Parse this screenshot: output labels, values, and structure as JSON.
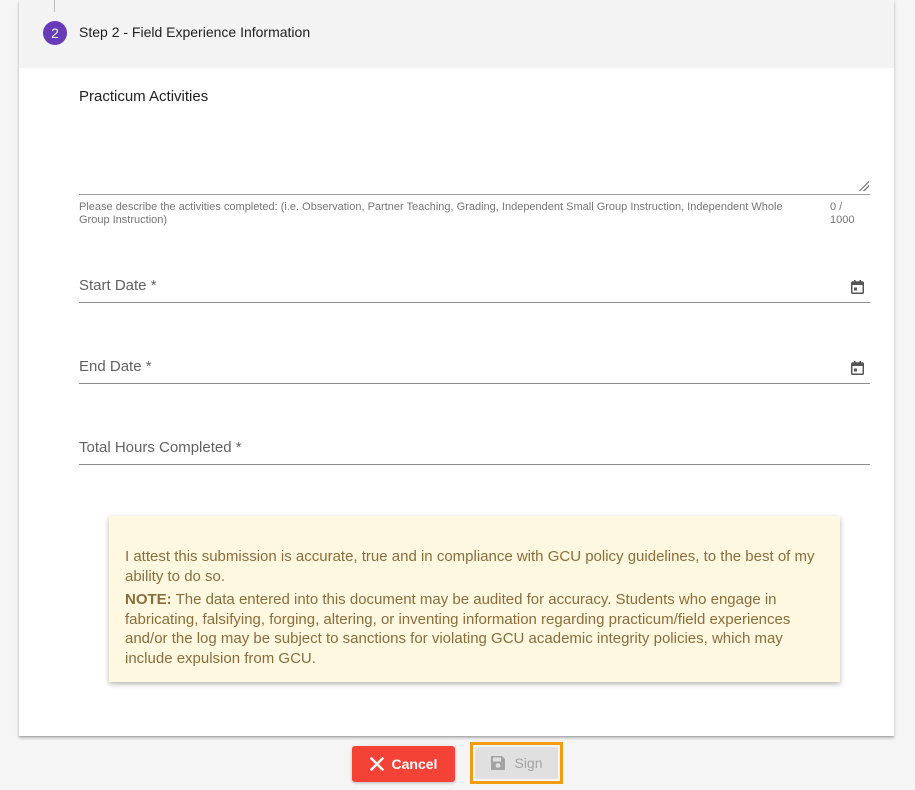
{
  "step": {
    "number": "2",
    "title": "Step 2 - Field Experience Information"
  },
  "practicum": {
    "label": "Practicum Activities",
    "value": "",
    "hint": "Please describe the activities completed: (i.e. Observation, Partner Teaching, Grading, Independent Small Group Instruction, Independent Whole Group Instruction)",
    "counter": "0 / 1000"
  },
  "start_date": {
    "label": "Start Date *",
    "icon": "calendar-icon"
  },
  "end_date": {
    "label": "End Date *",
    "icon": "calendar-icon"
  },
  "total_hours": {
    "label": "Total Hours Completed *"
  },
  "notice": {
    "attest": "I attest this submission is accurate, true and in compliance with GCU policy guidelines, to the best of my ability to do so.",
    "note_label": "NOTE:",
    "note_text": " The data entered into this document may be audited for accuracy. Students who engage in fabricating, falsifying, forging, altering, or inventing information regarding practicum/field experiences and/or the log may be subject to sanctions for violating GCU academic integrity policies, which may include expulsion from GCU."
  },
  "actions": {
    "cancel_label": "Cancel",
    "sign_label": "Sign"
  },
  "colors": {
    "step_accent": "#673ab7",
    "cancel": "#f44336",
    "focus_outline": "#f39c12",
    "notice_bg": "#fff8e1"
  }
}
